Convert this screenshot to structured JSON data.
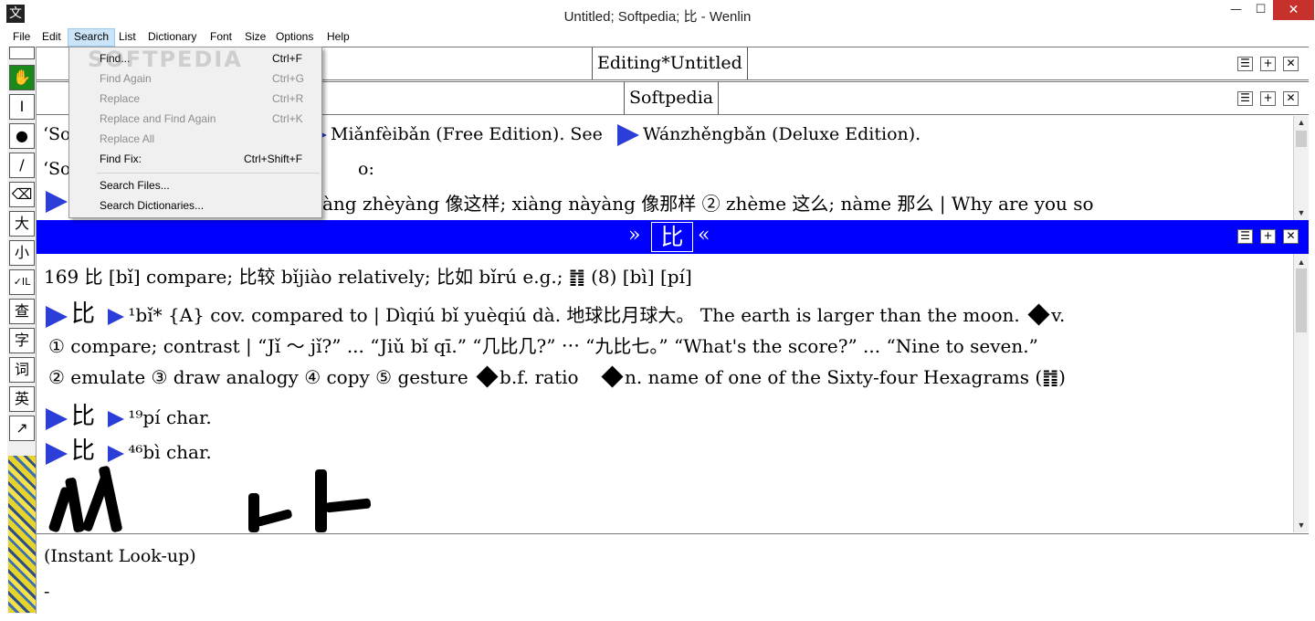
{
  "window": {
    "title": "Untitled; Softpedia; 比 - Wenlin",
    "app_icon": "wenlin-icon"
  },
  "menubar": [
    "File",
    "Edit",
    "Search",
    "List",
    "Dictionary",
    "Font",
    "Size",
    "Options",
    "Help"
  ],
  "search_menu": [
    {
      "label": "Find...",
      "shortcut": "Ctrl+F",
      "enabled": true
    },
    {
      "label": "Find Again",
      "shortcut": "Ctrl+G",
      "enabled": false
    },
    {
      "label": "Replace",
      "shortcut": "Ctrl+R",
      "enabled": false
    },
    {
      "label": "Replace and Find Again",
      "shortcut": "Ctrl+K",
      "enabled": false
    },
    {
      "label": "Replace All",
      "shortcut": "",
      "enabled": false
    },
    {
      "label": "Find Fix:",
      "shortcut": "Ctrl+Shift+F",
      "enabled": true
    },
    {
      "label": "Search Files...",
      "shortcut": "",
      "enabled": true
    },
    {
      "label": "Search Dictionaries...",
      "shortcut": "",
      "enabled": true
    }
  ],
  "watermark": "SOFTPEDIA",
  "toolbar": {
    "tools": [
      "hand-icon",
      "text-cursor-icon",
      "dot-icon",
      "brush-icon",
      "eraser-icon"
    ],
    "char_tools": [
      "大",
      "小",
      "✓IL",
      "查",
      "字",
      "词",
      "英",
      "↗"
    ]
  },
  "pane_editing": {
    "title": "Editing*Untitled"
  },
  "pane_softpedia": {
    "title": "Softpedia",
    "line1_start": "‘So",
    "line1_mid": "Miǎnfèibǎn (Free Edition). See",
    "line1_end": "Wánzhěngbǎn (Deluxe Edition).",
    "line2_start": "‘So",
    "line2_end": "o:",
    "line3": "àng zhèyàng 像这样; xiàng nàyàng 像那样 ② zhème 这么; nàme 那么 | Why are you so"
  },
  "entry_bar": {
    "char": "比",
    "left_chev": "»",
    "right_chev": "«"
  },
  "entry": {
    "line1": "169  比 [bǐ] compare; 比较 bǐjiào relatively; 比如 bǐrú e.g.; ䷇ (8)  [bì] [pí]",
    "line2a": "比",
    "line2b": "¹bǐ* {A} cov. compared to | Dìqiú bǐ yuèqiú dà. 地球比月球大。 The earth is larger than the moon.",
    "line2c": "v.",
    "line3": "① compare; contrast | “Jǐ 〜 jǐ?” ... “Jiǔ bǐ qī.” “几比几?” ⋯ “九比七。” “What's the score?” ... “Nine to seven.”",
    "line4a": "② emulate  ③ draw analogy  ④ copy  ⑤ gesture",
    "line4b": "b.f. ratio",
    "line4c": "n. name of one of the Sixty-four Hexagrams (䷇)",
    "line5a": "比",
    "line5b": "¹⁹pí char.",
    "line6a": "比",
    "line6b": "⁴⁶bì char."
  },
  "lookup": {
    "title": "(Instant Look-up)",
    "cursor": "-"
  },
  "pane_buttons": {
    "menu": "☰",
    "plus": "+",
    "close": "✕"
  }
}
